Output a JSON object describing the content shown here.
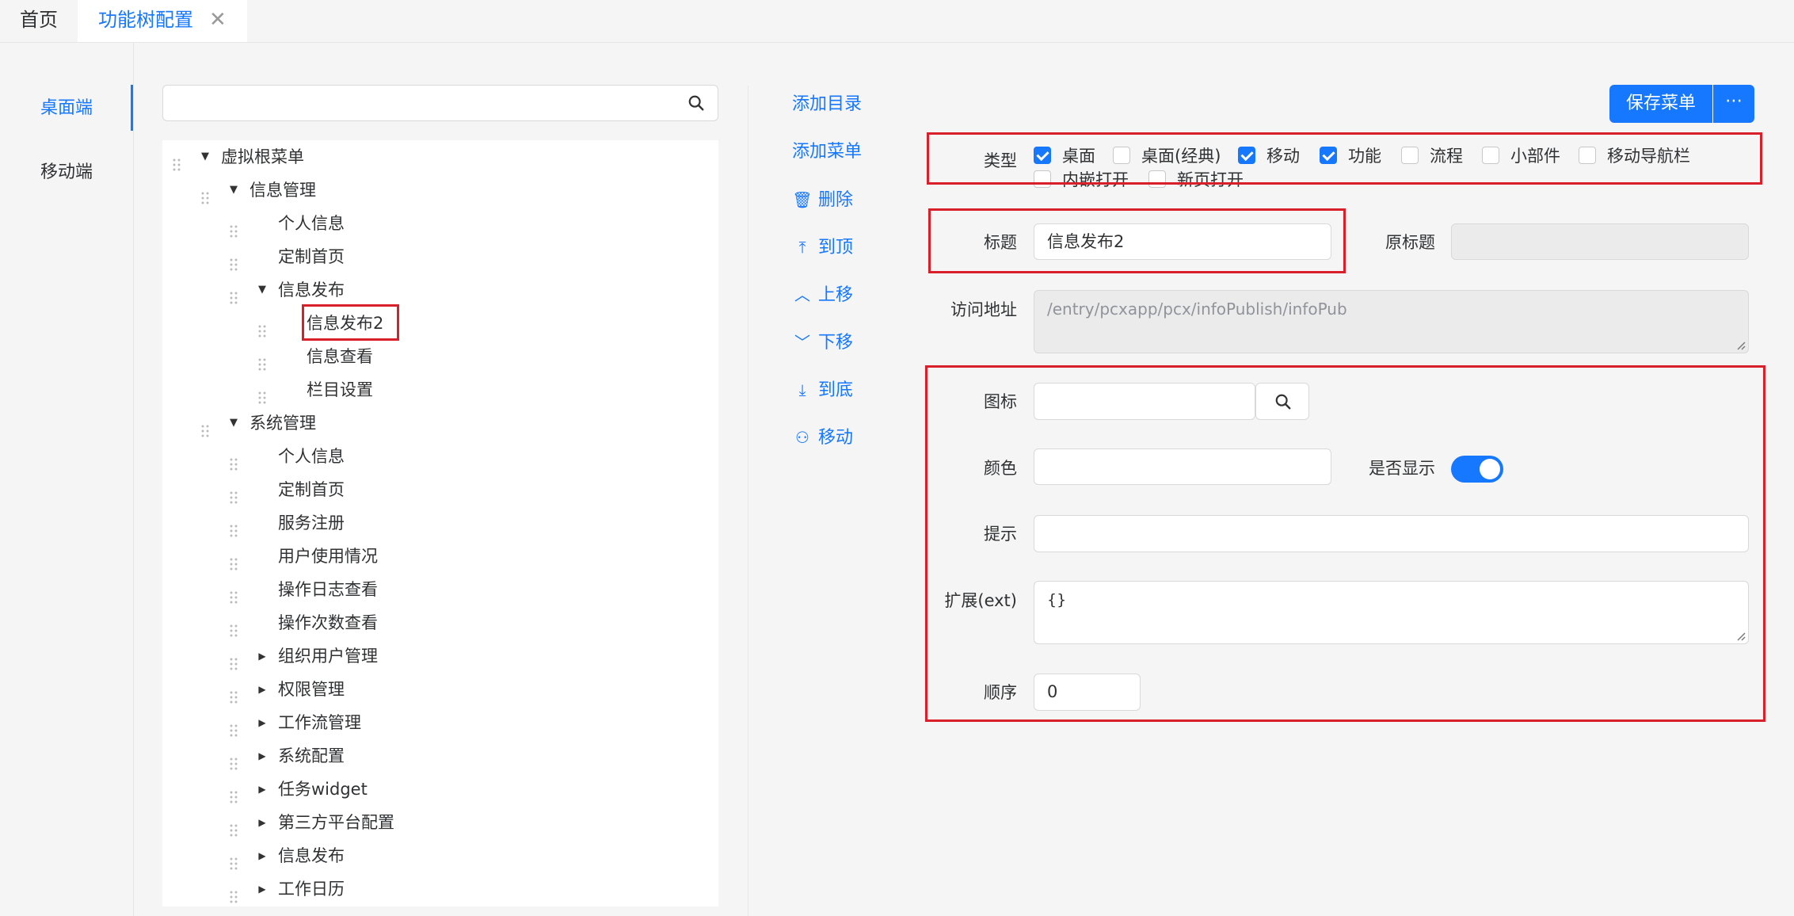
{
  "tabs": {
    "home": "首页",
    "active": "功能树配置",
    "close": "✕"
  },
  "sidenav": {
    "items": [
      {
        "label": "桌面端",
        "active": true
      },
      {
        "label": "移动端",
        "active": false
      }
    ]
  },
  "search": {
    "placeholder": "",
    "icon": "search-icon"
  },
  "tree": {
    "root": {
      "label": "虚拟根菜单",
      "expanded": true
    },
    "info_mgmt": {
      "label": "信息管理",
      "expanded": true
    },
    "info_children": [
      "个人信息",
      "定制首页"
    ],
    "info_publish": {
      "label": "信息发布",
      "expanded": true
    },
    "publish_children": [
      "信息发布2",
      "信息查看",
      "栏目设置"
    ],
    "selected": "信息发布2",
    "sys_mgmt": {
      "label": "系统管理",
      "expanded": true
    },
    "sys_leaf_children": [
      "个人信息",
      "定制首页",
      "服务注册",
      "用户使用情况",
      "操作日志查看",
      "操作次数查看"
    ],
    "sys_collapsed_children": [
      "组织用户管理",
      "权限管理",
      "工作流管理",
      "系统配置",
      "任务widget",
      "第三方平台配置",
      "信息发布",
      "工作日历"
    ]
  },
  "actions": {
    "add_dir": "添加目录",
    "add_menu": "添加菜单",
    "delete": "删除",
    "to_top": "到顶",
    "move_up": "上移",
    "move_down": "下移",
    "to_bottom": "到底",
    "move": "移动"
  },
  "toolbar": {
    "save_label": "保存菜单",
    "more_label": "⋯"
  },
  "form": {
    "type_label": "类型",
    "types": [
      {
        "label": "桌面",
        "checked": true
      },
      {
        "label": "桌面(经典)",
        "checked": false
      },
      {
        "label": "移动",
        "checked": true
      },
      {
        "label": "功能",
        "checked": true
      },
      {
        "label": "流程",
        "checked": false
      },
      {
        "label": "小部件",
        "checked": false
      },
      {
        "label": "移动导航栏",
        "checked": false
      },
      {
        "label": "内嵌打开",
        "checked": false
      },
      {
        "label": "新页打开",
        "checked": false
      }
    ],
    "title_label": "标题",
    "title_value": "信息发布2",
    "orig_title_label": "原标题",
    "orig_title_value": "",
    "url_label": "访问地址",
    "url_value": "/entry/pcxapp/pcx/infoPublish/infoPub",
    "icon_label": "图标",
    "icon_value": "",
    "color_label": "颜色",
    "color_value": "",
    "show_label": "是否显示",
    "show_value": true,
    "hint_label": "提示",
    "hint_value": "",
    "ext_label": "扩展(ext)",
    "ext_value": "{}",
    "order_label": "顺序",
    "order_value": "0"
  },
  "colors": {
    "accent": "#1677ff",
    "highlight_border": "#d9202a"
  }
}
